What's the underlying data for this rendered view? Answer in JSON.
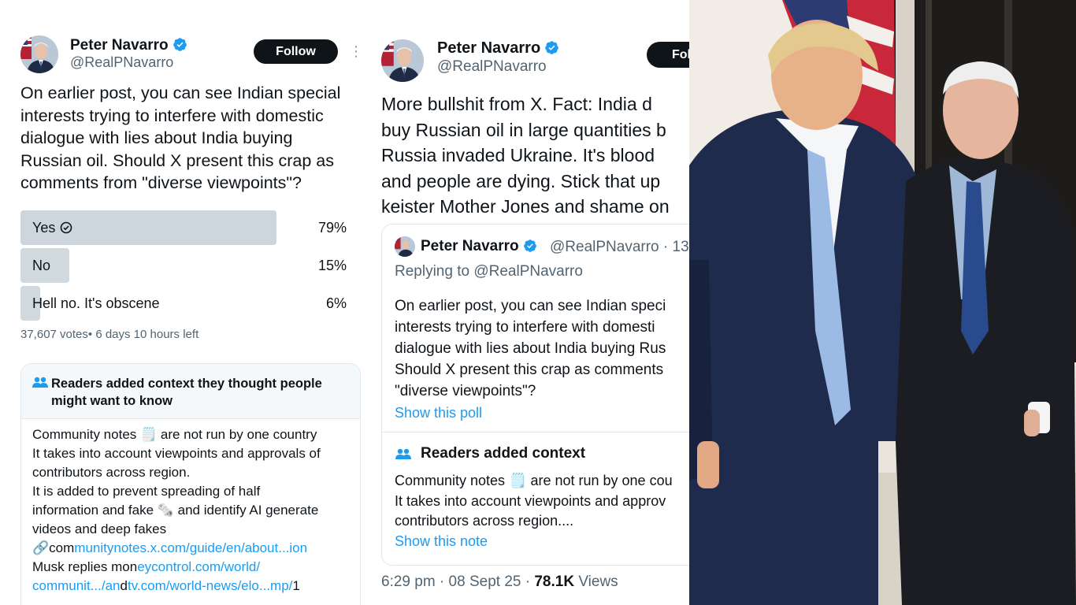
{
  "left_tweet": {
    "author_name": "Peter Navarro",
    "author_handle": "@RealPNavarro",
    "follow_label": "Follow",
    "more_label": "⋮",
    "text": "On earlier post, you can see Indian special\ninterests trying to interfere with domestic\ndialogue with lies about India buying\nRussian oil.  Should X present this crap as\ncomments from \"diverse viewpoints\"?",
    "poll": {
      "options": [
        {
          "label": "Yes",
          "percent": "79%",
          "value": 0.79,
          "winner": true
        },
        {
          "label": "No",
          "percent": "15%",
          "value": 0.15,
          "winner": false
        },
        {
          "label": "Hell no.  It's obscene",
          "percent": "6%",
          "value": 0.06,
          "winner": false
        }
      ],
      "meta": "37,607 votes• 6 days 10 hours left"
    },
    "community_note": {
      "title": "Readers added context they thought people might want to know",
      "lines": [
        {
          "text": "Community notes 🗒️ are not run by one country"
        },
        {
          "text": "It takes into account viewpoints and approvals of"
        },
        {
          "text": "contributors across region."
        },
        {
          "text": "It is added to prevent spreading of half"
        },
        {
          "text": "information and fake 🗞️ and identify AI generate"
        },
        {
          "text": "videos and deep fakes"
        }
      ],
      "link_line_1_prefix": "🔗com",
      "link_line_1_link": "munitynotes.x.com/guide/en/about...ion",
      "link_line_2_prefix": "Musk replies mon",
      "link_line_2_link": "eycontrol.com/world/",
      "link_line_3_link_a": "communit.../an",
      "link_line_3_mid": "d",
      "link_line_3_link_b": "tv.com/world-news/elo...mp/",
      "link_line_3_suffix": "1"
    }
  },
  "mid_tweet": {
    "author_name": "Peter Navarro",
    "author_handle": "@RealPNavarro",
    "follow_label": "Fol",
    "text_lines": [
      "More bullshit from X.   Fact: India d",
      "buy Russian oil in large quantities b",
      "Russia invaded Ukraine.  It's blood",
      "and people are dying.  Stick that up",
      "keister Mother Jones and shame on"
    ],
    "quote": {
      "author_name": "Peter Navarro",
      "author_handle": "@RealPNavarro · 13",
      "replying_to": "Replying to @RealPNavarro",
      "text_lines": [
        "On earlier post, you can see Indian speci",
        "interests trying to interfere with domesti",
        "dialogue with lies about India buying Rus",
        "Should X present this crap as comments",
        "\"diverse viewpoints\"?"
      ],
      "show_poll": "Show this poll",
      "note_title": "Readers added context",
      "note_lines": [
        "Community notes 🗒️ are not run by one cou",
        "It takes into account viewpoints and approv",
        "contributors across region...."
      ],
      "show_note": "Show this note"
    },
    "time": "6:29 pm · 08 Sept 25 · ",
    "views_count": "78.1K",
    "views_label": " Views"
  },
  "colors": {
    "link": "#1d9bf0",
    "verified": "#1d9bf0",
    "poll_bar": "#cfd9de",
    "follow_bg": "#0f1419"
  },
  "icons": [
    "verified-badge-icon",
    "check-circle-icon",
    "people-icon",
    "more-options-icon"
  ]
}
